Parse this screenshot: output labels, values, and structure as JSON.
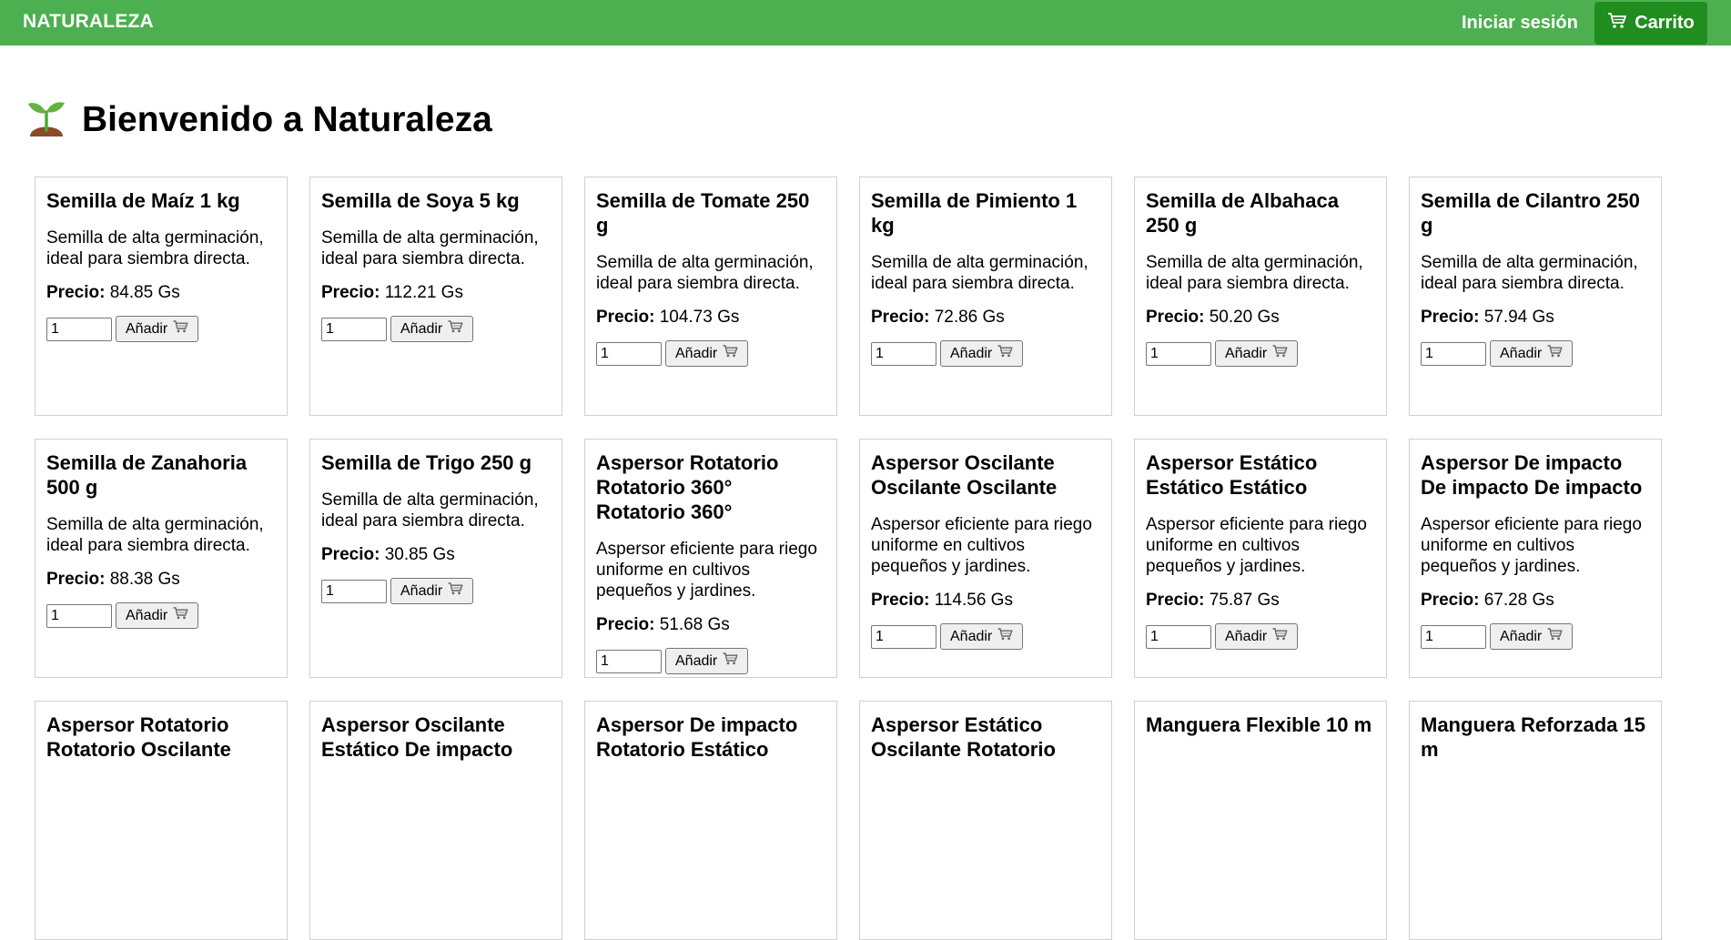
{
  "navbar": {
    "brand": "NATURALEZA",
    "login_label": "Iniciar sesión",
    "cart_label": "Carrito"
  },
  "page": {
    "title": "Bienvenido a Naturaleza"
  },
  "labels": {
    "price_label": "Precio:",
    "add_label": "Añadir"
  },
  "colors": {
    "navbar_bg": "#4caf50",
    "cart_button_bg": "#1f8e1f"
  },
  "products": [
    {
      "name": "Semilla de Maíz 1 kg",
      "description": "Semilla de alta germinación, ideal para siembra directa.",
      "price": "84.85 Gs",
      "qty": "1"
    },
    {
      "name": "Semilla de Soya 5 kg",
      "description": "Semilla de alta germinación, ideal para siembra directa.",
      "price": "112.21 Gs",
      "qty": "1"
    },
    {
      "name": "Semilla de Tomate 250 g",
      "description": "Semilla de alta germinación, ideal para siembra directa.",
      "price": "104.73 Gs",
      "qty": "1"
    },
    {
      "name": "Semilla de Pimiento 1 kg",
      "description": "Semilla de alta germinación, ideal para siembra directa.",
      "price": "72.86 Gs",
      "qty": "1"
    },
    {
      "name": "Semilla de Albahaca 250 g",
      "description": "Semilla de alta germinación, ideal para siembra directa.",
      "price": "50.20 Gs",
      "qty": "1"
    },
    {
      "name": "Semilla de Cilantro 250 g",
      "description": "Semilla de alta germinación, ideal para siembra directa.",
      "price": "57.94 Gs",
      "qty": "1"
    },
    {
      "name": "Semilla de Zanahoria 500 g",
      "description": "Semilla de alta germinación, ideal para siembra directa.",
      "price": "88.38 Gs",
      "qty": "1"
    },
    {
      "name": "Semilla de Trigo 250 g",
      "description": "Semilla de alta germinación, ideal para siembra directa.",
      "price": "30.85 Gs",
      "qty": "1"
    },
    {
      "name": "Aspersor Rotatorio Rotatorio 360° Rotatorio 360°",
      "description": "Aspersor eficiente para riego uniforme en cultivos pequeños y jardines.",
      "price": "51.68 Gs",
      "qty": "1"
    },
    {
      "name": "Aspersor Oscilante Oscilante Oscilante",
      "description": "Aspersor eficiente para riego uniforme en cultivos pequeños y jardines.",
      "price": "114.56 Gs",
      "qty": "1"
    },
    {
      "name": "Aspersor Estático Estático Estático",
      "description": "Aspersor eficiente para riego uniforme en cultivos pequeños y jardines.",
      "price": "75.87 Gs",
      "qty": "1"
    },
    {
      "name": "Aspersor De impacto De impacto De impacto",
      "description": "Aspersor eficiente para riego uniforme en cultivos pequeños y jardines.",
      "price": "67.28 Gs",
      "qty": "1"
    },
    {
      "name": "Aspersor Rotatorio Rotatorio Oscilante",
      "description": "",
      "price": "",
      "qty": ""
    },
    {
      "name": "Aspersor Oscilante Estático De impacto",
      "description": "",
      "price": "",
      "qty": ""
    },
    {
      "name": "Aspersor De impacto Rotatorio Estático",
      "description": "",
      "price": "",
      "qty": ""
    },
    {
      "name": "Aspersor Estático Oscilante Rotatorio",
      "description": "",
      "price": "",
      "qty": ""
    },
    {
      "name": "Manguera Flexible 10 m",
      "description": "",
      "price": "",
      "qty": ""
    },
    {
      "name": "Manguera Reforzada 15 m",
      "description": "",
      "price": "",
      "qty": ""
    }
  ]
}
